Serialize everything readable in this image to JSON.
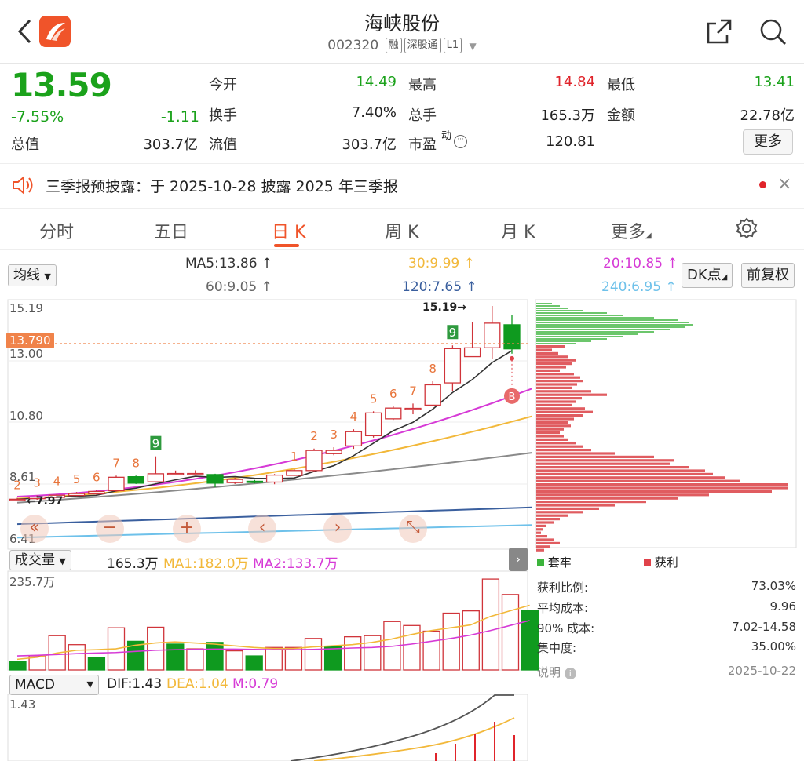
{
  "header": {
    "back_icon": "chevron-left-icon",
    "app_icon": "app-logo-icon",
    "title": "海峡股份",
    "code": "002320",
    "tags": [
      "融",
      "深股通",
      "L1"
    ],
    "share_icon": "share-icon",
    "search_icon": "search-icon"
  },
  "quote": {
    "price": "13.59",
    "change_pct": "-7.55%",
    "change": "-1.11",
    "items": [
      {
        "label": "今开",
        "value": "14.49",
        "color": "green"
      },
      {
        "label": "最高",
        "value": "14.84",
        "color": "red"
      },
      {
        "label": "最低",
        "value": "13.41",
        "color": "green"
      },
      {
        "label": "换手",
        "value": "7.40%",
        "color": "black"
      },
      {
        "label": "总手",
        "value": "165.3万",
        "color": "black"
      },
      {
        "label": "金额",
        "value": "22.78亿",
        "color": "black"
      },
      {
        "label": "总值",
        "value": "303.7亿",
        "color": "black"
      },
      {
        "label": "流值",
        "value": "303.7亿",
        "color": "black"
      },
      {
        "label": "市盈",
        "value": "120.81",
        "color": "black"
      }
    ],
    "pe_sup": "动",
    "more_label": "更多"
  },
  "notice": {
    "text": "三季报预披露：于 2025-10-28 披露 2025 年三季报"
  },
  "tabs": [
    "分时",
    "五日",
    "日 K",
    "周 K",
    "月 K",
    "更多"
  ],
  "active_tab": 2,
  "ma": {
    "select_label": "均线",
    "items": [
      {
        "text": "MA5:13.86 ↑",
        "color": "#333333"
      },
      {
        "text": "30:9.99 ↑",
        "color": "#f2b83a"
      },
      {
        "text": "20:10.85 ↑",
        "color": "#d63ad6"
      },
      {
        "text": "60:9.05 ↑",
        "color": "#666666"
      },
      {
        "text": "120:7.65 ↑",
        "color": "#3a5f9e"
      },
      {
        "text": "240:6.95 ↑",
        "color": "#6ec1ea"
      }
    ],
    "dk_label": "DK点",
    "adj_label": "前复权"
  },
  "kchart": {
    "y_labels": [
      "15.19",
      "13.00",
      "10.80",
      "8.61",
      "6.41"
    ],
    "crosshair_price": "13.790",
    "max_label": "15.19→",
    "min_label": "←7.97",
    "b_marker": "B",
    "candles": [
      {
        "o": 7.98,
        "c": 7.98,
        "h": 8.03,
        "l": 7.93
      },
      {
        "o": 8.0,
        "c": 8.06,
        "h": 8.12,
        "l": 7.96
      },
      {
        "o": 8.05,
        "c": 8.13,
        "h": 8.18,
        "l": 8.02
      },
      {
        "o": 8.12,
        "c": 8.19,
        "h": 8.25,
        "l": 8.1
      },
      {
        "o": 8.18,
        "c": 8.27,
        "h": 8.32,
        "l": 8.15
      },
      {
        "o": 8.3,
        "c": 8.8,
        "h": 8.86,
        "l": 8.26
      },
      {
        "o": 8.82,
        "c": 8.58,
        "h": 8.86,
        "l": 8.55
      },
      {
        "o": 8.63,
        "c": 8.93,
        "h": 9.58,
        "l": 8.6
      },
      {
        "o": 8.94,
        "c": 8.94,
        "h": 9.05,
        "l": 8.88
      },
      {
        "o": 8.93,
        "c": 8.94,
        "h": 9.06,
        "l": 8.87
      },
      {
        "o": 8.9,
        "c": 8.58,
        "h": 8.93,
        "l": 8.43
      },
      {
        "o": 8.6,
        "c": 8.72,
        "h": 8.78,
        "l": 8.55
      },
      {
        "o": 8.65,
        "c": 8.63,
        "h": 8.7,
        "l": 8.57
      },
      {
        "o": 8.62,
        "c": 8.88,
        "h": 8.92,
        "l": 8.54
      },
      {
        "o": 8.87,
        "c": 9.05,
        "h": 9.1,
        "l": 8.85
      },
      {
        "o": 9.05,
        "c": 9.8,
        "h": 9.87,
        "l": 9.02
      },
      {
        "o": 9.68,
        "c": 9.8,
        "h": 9.92,
        "l": 9.62
      },
      {
        "o": 9.97,
        "c": 10.5,
        "h": 10.59,
        "l": 9.86
      },
      {
        "o": 10.35,
        "c": 11.2,
        "h": 11.26,
        "l": 10.28
      },
      {
        "o": 10.98,
        "c": 11.38,
        "h": 11.45,
        "l": 10.94
      },
      {
        "o": 11.37,
        "c": 11.37,
        "h": 11.55,
        "l": 11.15
      },
      {
        "o": 11.49,
        "c": 12.25,
        "h": 12.38,
        "l": 11.46
      },
      {
        "o": 12.32,
        "c": 13.6,
        "h": 13.72,
        "l": 12.0
      },
      {
        "o": 13.3,
        "c": 13.63,
        "h": 14.6,
        "l": 13.3
      },
      {
        "o": 13.63,
        "c": 14.55,
        "h": 15.19,
        "l": 13.21
      },
      {
        "o": 14.49,
        "c": 13.59,
        "h": 14.84,
        "l": 13.41
      }
    ],
    "signals": [
      {
        "i": 0,
        "t": "2",
        "g": false
      },
      {
        "i": 1,
        "t": "3",
        "g": false
      },
      {
        "i": 2,
        "t": "4",
        "g": false
      },
      {
        "i": 3,
        "t": "5",
        "g": false
      },
      {
        "i": 4,
        "t": "6",
        "g": false
      },
      {
        "i": 5,
        "t": "7",
        "g": false
      },
      {
        "i": 6,
        "t": "8",
        "g": false
      },
      {
        "i": 7,
        "t": "9",
        "g": true
      },
      {
        "i": 14,
        "t": "1",
        "g": false
      },
      {
        "i": 15,
        "t": "2",
        "g": false
      },
      {
        "i": 16,
        "t": "3",
        "g": false
      },
      {
        "i": 17,
        "t": "4",
        "g": false
      },
      {
        "i": 18,
        "t": "5",
        "g": false
      },
      {
        "i": 19,
        "t": "6",
        "g": false
      },
      {
        "i": 20,
        "t": "7",
        "g": false
      },
      {
        "i": 21,
        "t": "8",
        "g": false
      },
      {
        "i": 22,
        "t": "9",
        "g": true
      }
    ],
    "controls": [
      "rewind-icon",
      "zoom-out-icon",
      "zoom-in-icon",
      "prev-icon",
      "next-icon",
      "fullscreen-icon"
    ]
  },
  "volume": {
    "select_label": "成交量",
    "vol": "165.3万",
    "ma1": "MA1:182.0万",
    "ma2": "MA2:133.7万",
    "max_label": "235.7万",
    "bars": [
      {
        "v": 30,
        "up": false
      },
      {
        "v": 50,
        "up": true
      },
      {
        "v": 122,
        "up": true
      },
      {
        "v": 90,
        "up": true
      },
      {
        "v": 45,
        "up": false
      },
      {
        "v": 150,
        "up": true
      },
      {
        "v": 102,
        "up": false
      },
      {
        "v": 152,
        "up": true
      },
      {
        "v": 92,
        "up": false
      },
      {
        "v": 75,
        "up": true
      },
      {
        "v": 98,
        "up": false
      },
      {
        "v": 68,
        "up": true
      },
      {
        "v": 50,
        "up": false
      },
      {
        "v": 80,
        "up": true
      },
      {
        "v": 80,
        "up": true
      },
      {
        "v": 112,
        "up": true
      },
      {
        "v": 83,
        "up": false
      },
      {
        "v": 118,
        "up": true
      },
      {
        "v": 122,
        "up": true
      },
      {
        "v": 172,
        "up": true
      },
      {
        "v": 158,
        "up": true
      },
      {
        "v": 138,
        "up": true
      },
      {
        "v": 202,
        "up": true
      },
      {
        "v": 210,
        "up": true
      },
      {
        "v": 323,
        "up": true
      },
      {
        "v": 268,
        "up": true
      },
      {
        "v": 212,
        "up": false
      }
    ]
  },
  "macd": {
    "select_label": "MACD",
    "dif": "DIF:1.43",
    "dea": "DEA:1.04",
    "m": "M:0.79",
    "max_label": "1.43"
  },
  "chips": {
    "legend": [
      {
        "label": "套牢",
        "color": "#3cb43c"
      },
      {
        "label": "获利",
        "color": "#e0424a"
      }
    ],
    "stats": [
      {
        "label": "获利比例:",
        "value": "73.03%"
      },
      {
        "label": "平均成本:",
        "value": "9.96"
      },
      {
        "label": "90% 成本:",
        "value": "7.02-14.58"
      },
      {
        "label": "集中度:",
        "value": "35.00%"
      }
    ],
    "note_label": "说明",
    "date": "2025-10-22"
  }
}
